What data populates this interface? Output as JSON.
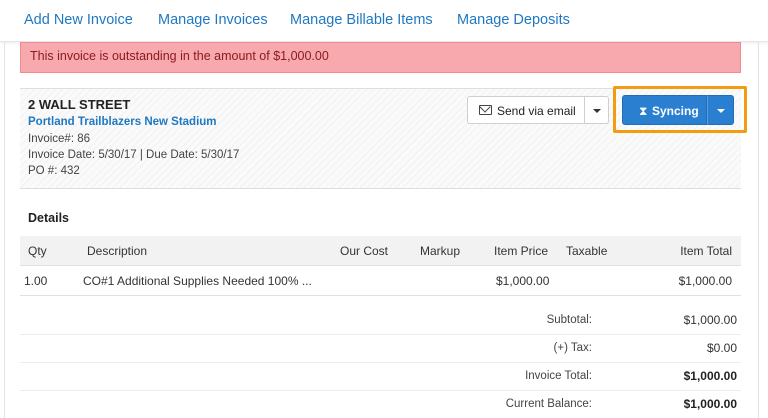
{
  "nav": {
    "items": [
      "Add New Invoice",
      "Manage Invoices",
      "Manage Billable Items",
      "Manage Deposits"
    ]
  },
  "alert": {
    "text": "This invoice is outstanding in the amount of $1,000.00"
  },
  "invoice": {
    "job_name": "2 WALL STREET",
    "project": "Portland Trailblazers New Stadium",
    "invoice_number": "Invoice#: 86",
    "dates": "Invoice Date: 5/30/17 | Due Date: 5/30/17",
    "po": "PO #: 432"
  },
  "actions": {
    "send_email_label": "Send via email",
    "syncing_label": "Syncing",
    "syncing_icon": "hourglass-icon"
  },
  "details": {
    "title": "Details",
    "columns": [
      "Qty",
      "Description",
      "Our Cost",
      "Markup",
      "Item Price",
      "Taxable",
      "Item Total"
    ],
    "rows": [
      {
        "qty": "1.00",
        "description": "CO#1 Additional Supplies Needed 100% ...",
        "our_cost": "",
        "markup": "",
        "item_price": "$1,000.00",
        "taxable": "",
        "item_total": "$1,000.00"
      }
    ]
  },
  "summary": {
    "subtotal_label": "Subtotal:",
    "subtotal": "$1,000.00",
    "tax_label": "(+) Tax:",
    "tax": "$0.00",
    "total_label": "Invoice Total:",
    "total": "$1,000.00",
    "balance_label": "Current Balance:",
    "balance": "$1,000.00"
  },
  "colors": {
    "link": "#1f78c1",
    "alert_bg": "#f7a9ad",
    "primary_button": "#2a7fd0",
    "highlight": "#f39c12"
  }
}
